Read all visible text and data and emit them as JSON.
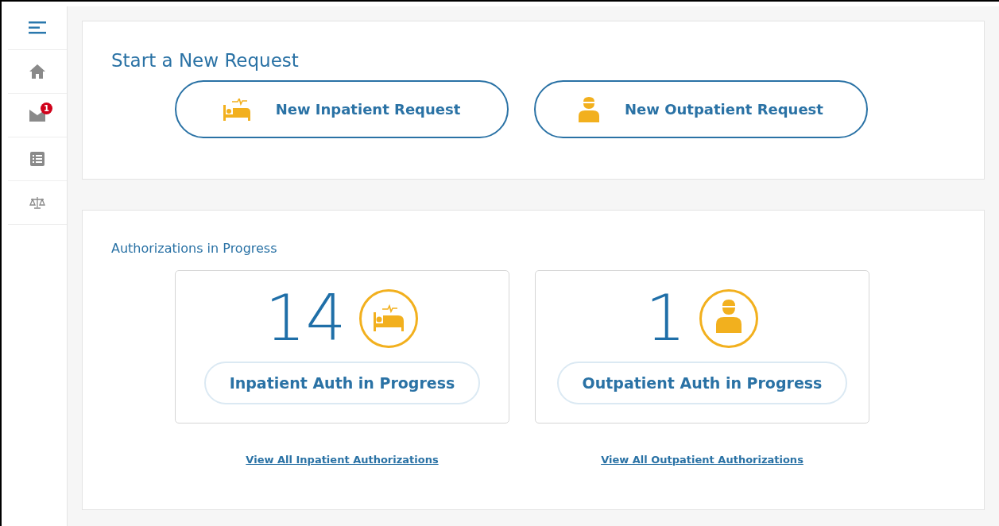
{
  "sidebar": {
    "items": [
      {
        "kind": "menu"
      },
      {
        "kind": "home"
      },
      {
        "kind": "mail",
        "badge": "1"
      },
      {
        "kind": "list"
      },
      {
        "kind": "scale"
      }
    ]
  },
  "new_request": {
    "title": "Start a New Request",
    "buttons": [
      {
        "kind": "inpatient",
        "label": "New Inpatient Request"
      },
      {
        "kind": "outpatient",
        "label": "New Outpatient Request"
      }
    ]
  },
  "in_progress": {
    "title": "Authorizations in Progress",
    "cards": [
      {
        "kind": "inpatient",
        "count": "14",
        "label": "Inpatient Auth in Progress",
        "link": "View All Inpatient Authorizations"
      },
      {
        "kind": "outpatient",
        "count": "1",
        "label": "Outpatient Auth in Progress",
        "link": "View All Outpatient Authorizations"
      }
    ]
  }
}
